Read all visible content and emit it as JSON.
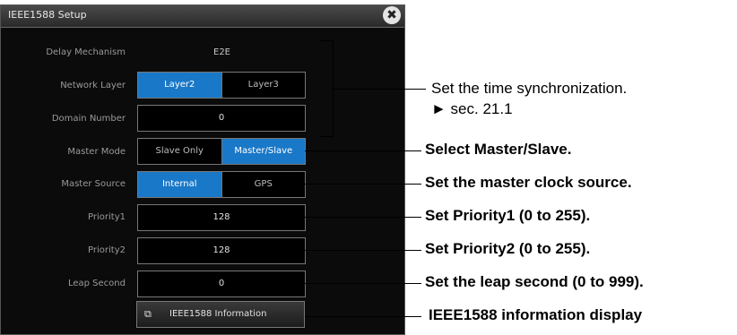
{
  "dialog": {
    "title": "IEEE1588 Setup",
    "close_glyph": "✖"
  },
  "fields": {
    "delay_mechanism": {
      "label": "Delay Mechanism",
      "value": "E2E"
    },
    "network_layer": {
      "label": "Network Layer",
      "options": [
        "Layer2",
        "Layer3"
      ],
      "selected": "Layer2"
    },
    "domain_number": {
      "label": "Domain Number",
      "value": "0"
    },
    "master_mode": {
      "label": "Master Mode",
      "options": [
        "Slave Only",
        "Master/Slave"
      ],
      "selected": "Master/Slave"
    },
    "master_source": {
      "label": "Master Source",
      "options": [
        "Internal",
        "GPS"
      ],
      "selected": "Internal"
    },
    "priority1": {
      "label": "Priority1",
      "value": "128"
    },
    "priority2": {
      "label": "Priority2",
      "value": "128"
    },
    "leap_second": {
      "label": "Leap Second",
      "value": "0"
    }
  },
  "info_button": {
    "label": "IEEE1588 Information",
    "icon": "window-icon",
    "icon_glyph": "⧉"
  },
  "annotations": {
    "sync_line1": "Set the time synchronization.",
    "sync_line2": "► sec. 21.1",
    "master_mode": "Select Master/Slave.",
    "master_source": "Set the master clock source.",
    "priority1": "Set Priority1 (0 to 255).",
    "priority2": "Set Priority2 (0 to 255).",
    "leap_second": "Set the leap second (0 to 999).",
    "info": "IEEE1588 information display"
  },
  "colors": {
    "selected": "#1a78c8",
    "dialog_bg": "#0b0b0b"
  }
}
